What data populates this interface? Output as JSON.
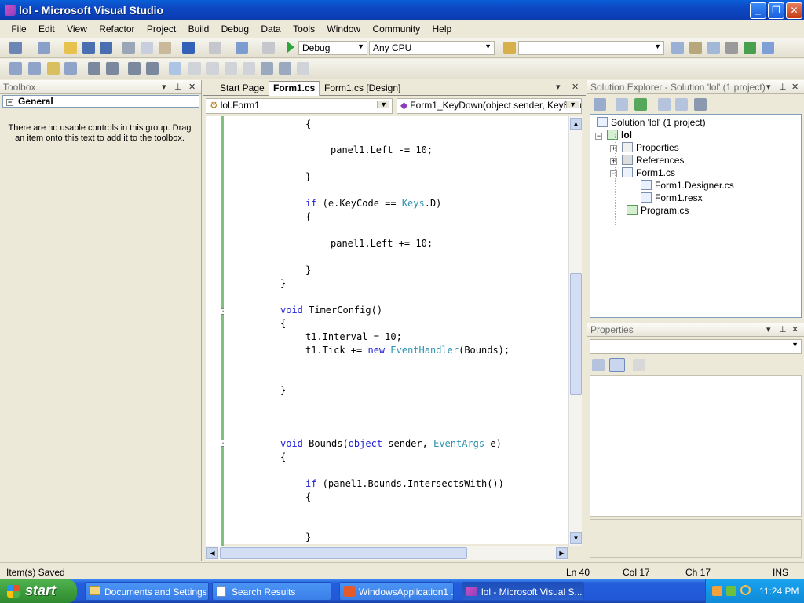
{
  "window": {
    "title": "lol - Microsoft Visual Studio"
  },
  "menu": [
    "File",
    "Edit",
    "View",
    "Refactor",
    "Project",
    "Build",
    "Debug",
    "Data",
    "Tools",
    "Window",
    "Community",
    "Help"
  ],
  "toolbar": {
    "config": "Debug",
    "platform": "Any CPU"
  },
  "toolbox": {
    "title": "Toolbox",
    "group": "General",
    "empty_message": "There are no usable controls in this group. Drag an item onto this text to add it to the toolbox."
  },
  "tabs": [
    "Start Page",
    "Form1.cs",
    "Form1.cs [Design]"
  ],
  "editor": {
    "class_combo": "lol.Form1",
    "member_combo": "Form1_KeyDown(object sender, KeyEver"
  },
  "code_lines": [
    {
      "indent": 1,
      "parts": [
        [
          "",
          "{"
        ]
      ]
    },
    {
      "indent": 2,
      "parts": [
        [
          "",
          "panel1.Left -= 10;"
        ]
      ]
    },
    {
      "indent": 1,
      "parts": [
        [
          "",
          "}"
        ]
      ]
    },
    {
      "indent": 1,
      "parts": [
        [
          "kw",
          "if"
        ],
        [
          "",
          " (e.KeyCode == "
        ],
        [
          "ty",
          "Keys"
        ],
        [
          "",
          ".D)"
        ]
      ]
    },
    {
      "indent": 1,
      "parts": [
        [
          "",
          "{"
        ]
      ]
    },
    {
      "indent": 2,
      "parts": [
        [
          "",
          "panel1.Left += 10;"
        ]
      ]
    },
    {
      "indent": 1,
      "parts": [
        [
          "",
          "}"
        ]
      ]
    },
    {
      "indent": 0,
      "parts": [
        [
          "",
          "}"
        ]
      ]
    },
    {
      "indent": 0,
      "parts": [
        [
          "kw",
          "void"
        ],
        [
          "",
          " TimerConfig()"
        ]
      ]
    },
    {
      "indent": 0,
      "parts": [
        [
          "",
          "{"
        ]
      ]
    },
    {
      "indent": 1,
      "parts": [
        [
          "",
          "t1.Interval = 10;"
        ]
      ]
    },
    {
      "indent": 1,
      "parts": [
        [
          "",
          "t1.Tick += "
        ],
        [
          "kw",
          "new"
        ],
        [
          "",
          " "
        ],
        [
          "ty",
          "EventHandler"
        ],
        [
          "",
          "(Bounds);"
        ]
      ]
    },
    {
      "indent": 0,
      "parts": [
        [
          "",
          "}"
        ]
      ]
    },
    {
      "indent": 0,
      "parts": [
        [
          "kw",
          "void"
        ],
        [
          "",
          " Bounds("
        ],
        [
          "kw",
          "object"
        ],
        [
          "",
          " sender, "
        ],
        [
          "ty",
          "EventArgs"
        ],
        [
          "",
          " e)"
        ]
      ]
    },
    {
      "indent": 0,
      "parts": [
        [
          "",
          "{"
        ]
      ]
    },
    {
      "indent": 1,
      "parts": [
        [
          "kw",
          "if"
        ],
        [
          "",
          " (panel1.Bounds.IntersectsWith())"
        ]
      ]
    },
    {
      "indent": 1,
      "parts": [
        [
          "",
          "{"
        ]
      ]
    },
    {
      "indent": 1,
      "parts": [
        [
          "",
          "}"
        ]
      ]
    }
  ],
  "solution_explorer": {
    "title": "Solution Explorer - Solution 'lol' (1 project)",
    "items": [
      {
        "label": "Solution 'lol' (1 project)",
        "icon": "solution-icon"
      },
      {
        "label": "lol",
        "icon": "csharp-project-icon"
      },
      {
        "label": "Properties",
        "icon": "properties-folder-icon"
      },
      {
        "label": "References",
        "icon": "references-icon"
      },
      {
        "label": "Form1.cs",
        "icon": "form-icon"
      },
      {
        "label": "Form1.Designer.cs",
        "icon": "cs-file-icon"
      },
      {
        "label": "Form1.resx",
        "icon": "resx-file-icon"
      },
      {
        "label": "Program.cs",
        "icon": "cs-file-icon"
      }
    ]
  },
  "properties": {
    "title": "Properties"
  },
  "status": {
    "message": "Item(s) Saved",
    "ln": "Ln 40",
    "col": "Col 17",
    "ch": "Ch 17",
    "mode": "INS"
  },
  "taskbar": {
    "start": "start",
    "tasks": [
      "Documents and Settings",
      "Search Results",
      "WindowsApplication1 ...",
      "lol - Microsoft Visual S..."
    ],
    "clock": "11:24 PM"
  }
}
